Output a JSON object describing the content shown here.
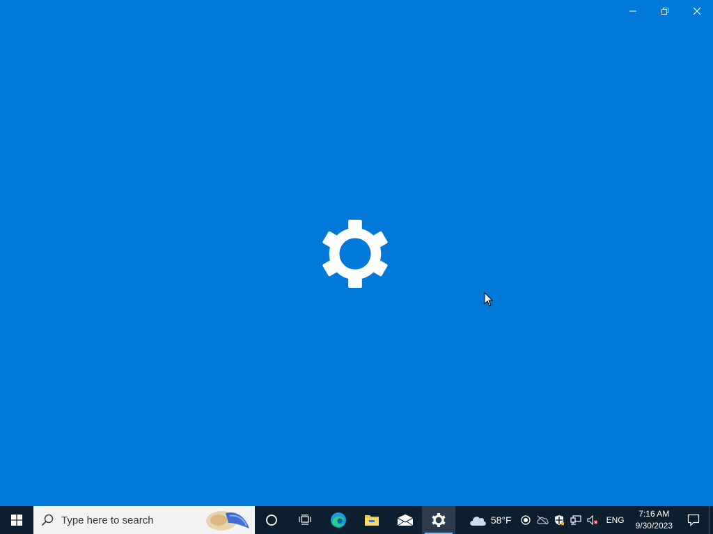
{
  "window": {
    "minimize_icon": "minimize-icon",
    "maximize_icon": "restore-icon",
    "close_icon": "close-icon",
    "splash_icon": "settings-gear-icon",
    "background": "#0078d7"
  },
  "taskbar": {
    "start_icon": "windows-logo-icon",
    "search_placeholder": "Type here to search",
    "pinned": [
      "cortana-icon",
      "task-view-icon",
      "edge-icon",
      "file-explorer-icon",
      "mail-icon",
      "settings-icon"
    ],
    "active_app": "settings-icon",
    "weather": {
      "icon": "cloud-icon",
      "temp": "58°F"
    },
    "tray_icons": [
      "record-icon",
      "onedrive-icon",
      "security-icon",
      "network-icon",
      "volume-muted-icon"
    ],
    "language": "ENG",
    "time": "7:16 AM",
    "date": "9/30/2023",
    "notification_icon": "action-center-icon"
  }
}
